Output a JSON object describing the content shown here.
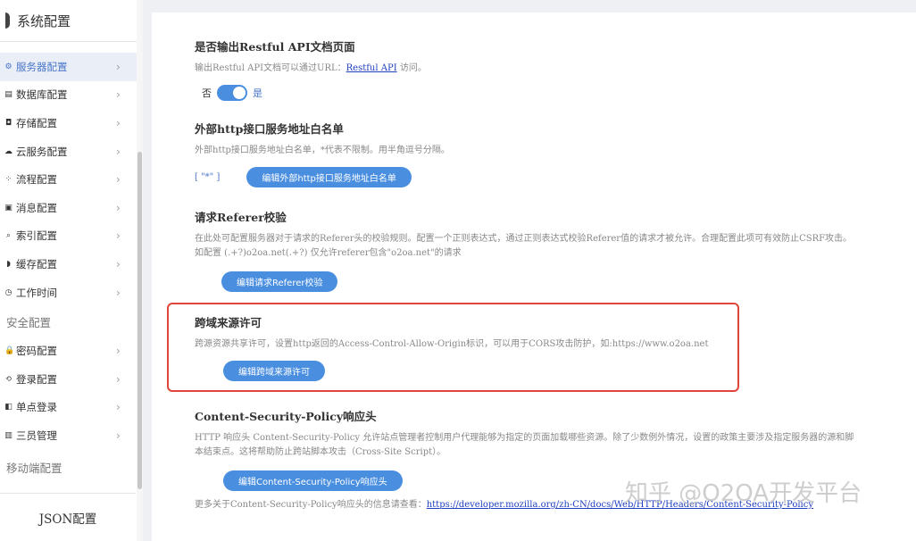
{
  "sidebar": {
    "title": "系统配置",
    "server_items": [
      {
        "label": "服务器配置",
        "icon": "server-icon",
        "glyph": "⚙",
        "active": true
      },
      {
        "label": "数据库配置",
        "icon": "database-icon",
        "glyph": "▤"
      },
      {
        "label": "存储配置",
        "icon": "storage-icon",
        "glyph": "◘"
      },
      {
        "label": "云服务配置",
        "icon": "cloud-icon",
        "glyph": "☁"
      },
      {
        "label": "流程配置",
        "icon": "flow-icon",
        "glyph": "⁘"
      },
      {
        "label": "消息配置",
        "icon": "message-icon",
        "glyph": "▣"
      },
      {
        "label": "索引配置",
        "icon": "index-icon",
        "glyph": "⌕"
      },
      {
        "label": "缓存配置",
        "icon": "cache-icon",
        "glyph": "◗"
      },
      {
        "label": "工作时间",
        "icon": "clock-icon",
        "glyph": "◷"
      }
    ],
    "security_title": "安全配置",
    "security_items": [
      {
        "label": "密码配置",
        "icon": "lock-icon",
        "glyph": "🔒"
      },
      {
        "label": "登录配置",
        "icon": "login-icon",
        "glyph": "⟲"
      },
      {
        "label": "单点登录",
        "icon": "sso-icon",
        "glyph": "◧"
      },
      {
        "label": "三员管理",
        "icon": "admin-icon",
        "glyph": "▥"
      }
    ],
    "mobile_title": "移动端配置",
    "json_label": "JSON配置"
  },
  "restful": {
    "title": "是否输出Restful API文档页面",
    "desc_prefix": "输出Restful API文档可以通过URL：",
    "link": "Restful API",
    "desc_suffix": " 访问。",
    "off_label": "否",
    "on_label": "是",
    "enabled": true
  },
  "whitelist": {
    "title": "外部http接口服务地址白名单",
    "desc": "外部http接口服务地址白名单，*代表不限制。用半角逗号分隔。",
    "value": "[ \"*\" ]",
    "button": "编辑外部http接口服务地址白名单"
  },
  "referer": {
    "title": "请求Referer校验",
    "desc": "在此处可配置服务器对于请求的Referer头的校验规则。配置一个正则表达式，通过正则表达式校验Referer值的请求才被允许。合理配置此项可有效防止CSRF攻击。如配置 (.+?)o2oa.net(.+?) 仅允许referer包含\"o2oa.net\"的请求",
    "button": "编辑请求Referer校验"
  },
  "cors": {
    "title": "跨域来源许可",
    "desc": "跨源资源共享许可，设置http返回的Access-Control-Allow-Origin标识，可以用于CORS攻击防护，如:https://www.o2oa.net",
    "button": "编辑跨域来源许可"
  },
  "csp": {
    "title": "Content-Security-Policy响应头",
    "desc": "HTTP 响应头 Content-Security-Policy 允许站点管理者控制用户代理能够为指定的页面加载哪些资源。除了少数例外情况，设置的政策主要涉及指定服务器的源和脚本结束点。这将帮助防止跨站脚本攻击（Cross-Site Script）。",
    "button": "编辑Content-Security-Policy响应头",
    "more_prefix": "更多关于Content-Security-Policy响应头的信息请查看：",
    "more_link": "https://developer.mozilla.org/zh-CN/docs/Web/HTTP/Headers/Content-Security-Policy"
  },
  "watermark": "知乎 @O2OA开发平台",
  "colors": {
    "accent": "#4a8ee0",
    "highlight": "#e0453a",
    "active_text": "#4a76c9"
  }
}
